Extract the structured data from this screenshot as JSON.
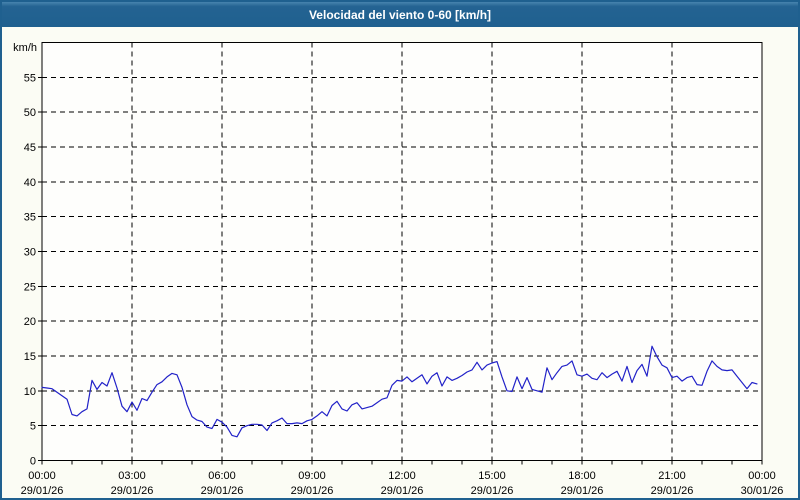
{
  "window": {
    "title": "Velocidad del viento 0-60 [km/h]"
  },
  "colors": {
    "titlebar_bg": "#1f608f",
    "titlebar_text": "#ffffff",
    "window_border": "#1f608f",
    "page_bg": "#fbfcf4",
    "plot_bg": "#fefefc",
    "grid": "#000000",
    "axis": "#000000",
    "tick_text": "#000000",
    "line": "#2222c8"
  },
  "chart_data": {
    "type": "line",
    "title": "Velocidad del viento 0-60 [km/h]",
    "ylabel": "km/h",
    "ylim": [
      0,
      60
    ],
    "ytick_step": 5,
    "yticks": [
      0,
      5,
      10,
      15,
      20,
      25,
      30,
      35,
      40,
      45,
      50,
      55
    ],
    "xlim_hours": [
      0,
      24
    ],
    "minor_xtick_every_hours": 1,
    "grid": "dashed",
    "legend_position": "none",
    "xticks": [
      {
        "hour": 0,
        "time": "00:00",
        "date": "29/01/26"
      },
      {
        "hour": 3,
        "time": "03:00",
        "date": "29/01/26"
      },
      {
        "hour": 6,
        "time": "06:00",
        "date": "29/01/26"
      },
      {
        "hour": 9,
        "time": "09:00",
        "date": "29/01/26"
      },
      {
        "hour": 12,
        "time": "12:00",
        "date": "29/01/26"
      },
      {
        "hour": 15,
        "time": "15:00",
        "date": "29/01/26"
      },
      {
        "hour": 18,
        "time": "18:00",
        "date": "29/01/26"
      },
      {
        "hour": 21,
        "time": "21:00",
        "date": "29/01/26"
      },
      {
        "hour": 24,
        "time": "00:00",
        "date": "30/01/26"
      }
    ],
    "series": [
      {
        "name": "velocidad-del-viento",
        "color": "#2222c8",
        "start": "29/01/26 00:00",
        "interval_minutes": 10,
        "values": [
          10.5,
          10.4,
          10.3,
          9.8,
          9.3,
          8.8,
          6.6,
          6.4,
          7.0,
          7.4,
          11.5,
          10.2,
          11.2,
          10.7,
          12.6,
          10.4,
          7.8,
          7.0,
          8.4,
          7.2,
          8.9,
          8.6,
          9.8,
          10.9,
          11.3,
          12.0,
          12.5,
          12.3,
          10.5,
          8.0,
          6.3,
          5.8,
          5.6,
          4.8,
          4.6,
          5.9,
          5.5,
          4.8,
          3.6,
          3.4,
          4.7,
          5.0,
          5.2,
          5.2,
          5.1,
          4.3,
          5.4,
          5.7,
          6.1,
          5.3,
          5.3,
          5.4,
          5.3,
          5.7,
          5.9,
          6.4,
          7.0,
          6.4,
          7.9,
          8.5,
          7.4,
          7.1,
          8.0,
          8.3,
          7.4,
          7.6,
          7.8,
          8.3,
          8.8,
          9.0,
          10.8,
          11.5,
          11.4,
          12.0,
          11.3,
          11.8,
          12.3,
          11.0,
          12.1,
          12.6,
          10.7,
          12.0,
          11.5,
          11.8,
          12.2,
          12.7,
          13.0,
          14.1,
          13.0,
          13.7,
          14.0,
          14.2,
          12.0,
          10.0,
          9.9,
          12.0,
          10.3,
          11.9,
          10.2,
          10.0,
          9.8,
          13.3,
          11.6,
          12.6,
          13.5,
          13.7,
          14.3,
          12.3,
          12.1,
          12.4,
          11.8,
          11.6,
          12.6,
          11.9,
          12.4,
          12.8,
          11.4,
          13.5,
          11.2,
          12.9,
          13.8,
          12.1,
          16.4,
          14.9,
          13.7,
          13.3,
          11.9,
          12.1,
          11.4,
          11.9,
          12.1,
          10.9,
          10.8,
          12.8,
          14.3,
          13.5,
          13.0,
          12.9,
          13.0,
          12.1,
          11.2,
          10.3,
          11.2,
          11.0
        ]
      }
    ]
  }
}
